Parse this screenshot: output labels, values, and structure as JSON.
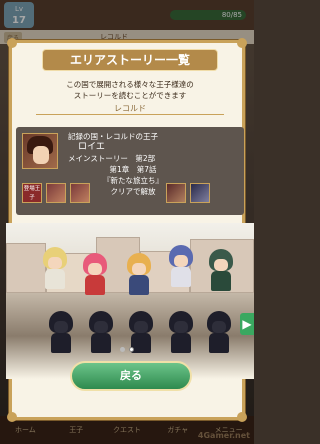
{
  "header": {
    "level_label": "Lv",
    "level": "17",
    "hp": "80/85"
  },
  "subheader": {
    "left_tab": "戻る",
    "center": "レコルド"
  },
  "modal": {
    "title": "エリアストーリー一覧",
    "description_line1": "この国で展開される様々な王子様達の",
    "description_line2": "ストーリーを読むことができます",
    "section": "レコルド"
  },
  "story_card": {
    "line1": "記録の国・レコルドの王子",
    "name": "ロイエ",
    "main_story": "メインストーリー　第2部",
    "chapter": "第1章　第7話",
    "episode": "『新たな旅立ち』",
    "unlock": "クリアで解放",
    "tag": "登場王子"
  },
  "back_button": "戻る",
  "nav": {
    "items": [
      "ホーム",
      "王子",
      "クエスト",
      "ガチャ",
      "メニュー"
    ]
  },
  "watermark": "4Gamer.net",
  "pagination": {
    "current": 1,
    "total": 2
  },
  "colors": {
    "accent": "#c9a25a",
    "button": "#3aa860",
    "title_bg": "#b38a4a"
  }
}
